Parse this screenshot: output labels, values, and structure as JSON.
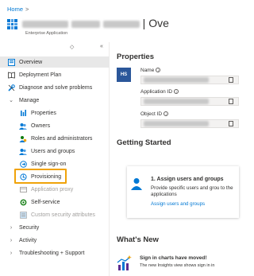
{
  "breadcrumb": {
    "home": "Home",
    "separator": ">"
  },
  "app": {
    "title_suffix": "| Ove",
    "subtitle": "Enterprise Application"
  },
  "sidebar": {
    "collapse_icons": [
      "◇",
      "«"
    ],
    "items": [
      {
        "label": "Overview",
        "icon": "overview-icon",
        "active": true
      },
      {
        "label": "Deployment Plan",
        "icon": "book-icon"
      },
      {
        "label": "Diagnose and solve problems",
        "icon": "wrench-icon"
      },
      {
        "label": "Manage",
        "icon": "chevron-down-icon",
        "group": true
      },
      {
        "label": "Properties",
        "icon": "properties-icon"
      },
      {
        "label": "Owners",
        "icon": "owners-icon"
      },
      {
        "label": "Roles and administrators",
        "icon": "roles-icon"
      },
      {
        "label": "Users and groups",
        "icon": "users-icon"
      },
      {
        "label": "Single sign-on",
        "icon": "sso-icon"
      },
      {
        "label": "Provisioning",
        "icon": "provisioning-icon",
        "highlighted": true
      },
      {
        "label": "Application proxy",
        "icon": "proxy-icon",
        "disabled": true
      },
      {
        "label": "Self-service",
        "icon": "self-service-icon"
      },
      {
        "label": "Custom security attributes",
        "icon": "attributes-icon",
        "disabled": true
      },
      {
        "label": "Security",
        "icon": "chevron-right-icon",
        "group": true
      },
      {
        "label": "Activity",
        "icon": "chevron-right-icon",
        "group": true
      },
      {
        "label": "Troubleshooting + Support",
        "icon": "chevron-right-icon",
        "group": true
      }
    ]
  },
  "properties": {
    "heading": "Properties",
    "avatar_initials": "HS",
    "fields": [
      {
        "label": "Name"
      },
      {
        "label": "Application ID"
      },
      {
        "label": "Object ID"
      }
    ]
  },
  "getting_started": {
    "heading": "Getting Started",
    "card_title": "1. Assign users and groups",
    "card_body": "Provide specific users and grou to the applications",
    "card_link": "Assign users and groups"
  },
  "whats_new": {
    "heading": "What's New",
    "item_title": "Sign in charts have moved!",
    "item_body": "The new Insights view shows sign in in"
  },
  "colors": {
    "accent": "#0078d4",
    "highlight": "#f0a30a",
    "avatar": "#2b579a"
  }
}
